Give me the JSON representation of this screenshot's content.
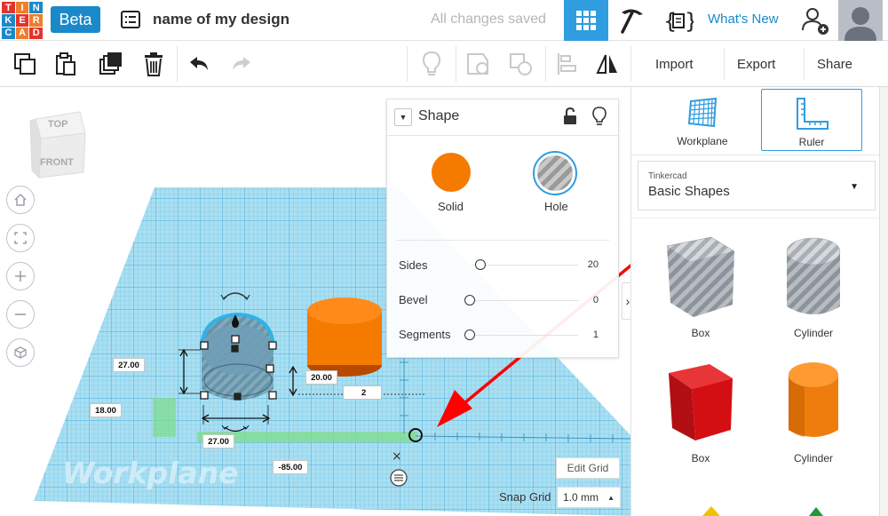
{
  "header": {
    "logo_letters": [
      "T",
      "I",
      "N",
      "K",
      "E",
      "R",
      "C",
      "A",
      "D"
    ],
    "beta_label": "Beta",
    "design_name": "name of my design",
    "save_status": "All changes saved",
    "whats_new_label": "What's New"
  },
  "toolbar": {
    "import_label": "Import",
    "export_label": "Export",
    "share_label": "Share"
  },
  "viewcube": {
    "top_label": "TOP",
    "front_label": "FRONT"
  },
  "shape_panel": {
    "title": "Shape",
    "solid_label": "Solid",
    "hole_label": "Hole",
    "solid_color": "#f57a00",
    "properties": [
      {
        "label": "Sides",
        "value": "20",
        "level": 0.1
      },
      {
        "label": "Bevel",
        "value": "0",
        "level": 0.0
      },
      {
        "label": "Segments",
        "value": "1",
        "level": 0.0
      }
    ]
  },
  "canvas": {
    "workplane_watermark": "Workplane",
    "dimensions": {
      "depth": "27.00",
      "left_offset": "18.00",
      "height": "20.00",
      "elevation": "2",
      "width": "27.00",
      "front_offset": "-85.00"
    },
    "edit_grid_label": "Edit Grid",
    "snap_grid_label": "Snap Grid",
    "snap_grid_value": "1.0 mm"
  },
  "sidebar": {
    "workplane_label": "Workplane",
    "ruler_label": "Ruler",
    "library_provider": "Tinkercad",
    "library_name": "Basic Shapes",
    "shapes": [
      {
        "label": "Box",
        "icon": "box-hole-icon"
      },
      {
        "label": "Cylinder",
        "icon": "cylinder-hole-icon"
      },
      {
        "label": "Box",
        "icon": "box-solid-icon",
        "color": "#d40f14"
      },
      {
        "label": "Cylinder",
        "icon": "cylinder-solid-icon",
        "color": "#ef7d0d"
      }
    ]
  },
  "colors": {
    "accent_blue": "#2f9de0",
    "workplane_blue": "#8fd2ec",
    "annotation_red": "#ff0000"
  }
}
